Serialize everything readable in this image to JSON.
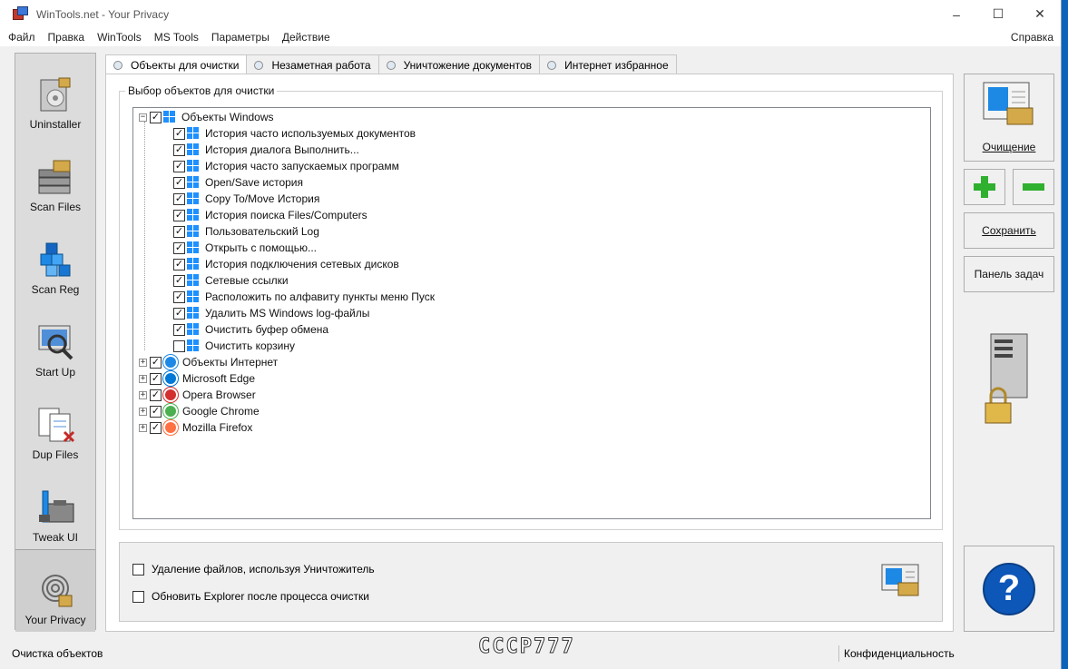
{
  "window": {
    "title": "WinTools.net - Your Privacy",
    "min": "–",
    "max": "☐",
    "close": "✕"
  },
  "menu": [
    "Файл",
    "Правка",
    "WinTools",
    "MS Tools",
    "Параметры",
    "Действие"
  ],
  "menu_help": "Справка",
  "nav": [
    {
      "label": "Uninstaller",
      "icon": "uninstaller-icon"
    },
    {
      "label": "Scan Files",
      "icon": "scan-files-icon"
    },
    {
      "label": "Scan Reg",
      "icon": "scan-reg-icon"
    },
    {
      "label": "Start Up",
      "icon": "startup-icon"
    },
    {
      "label": "Dup Files",
      "icon": "dup-files-icon"
    },
    {
      "label": "Tweak UI",
      "icon": "tweak-ui-icon"
    },
    {
      "label": "Your Privacy",
      "icon": "privacy-icon",
      "active": true
    }
  ],
  "tabs": [
    "Объекты для очистки",
    "Незаметная работа",
    "Уничтожение документов",
    "Интернет избранное"
  ],
  "group_title": "Выбор объектов для очистки",
  "tree": {
    "root": {
      "label": "Объекты Windows",
      "checked": true,
      "expanded": true
    },
    "children": [
      {
        "label": "История часто используемых документов",
        "checked": true
      },
      {
        "label": "История диалога Выполнить...",
        "checked": true
      },
      {
        "label": "История часто запускаемых программ",
        "checked": true
      },
      {
        "label": "Open/Save история",
        "checked": true
      },
      {
        "label": "Copy To/Move История",
        "checked": true
      },
      {
        "label": "История поиска Files/Computers",
        "checked": true
      },
      {
        "label": "Пользовательский Log",
        "checked": true
      },
      {
        "label": "Открыть с помощью...",
        "checked": true
      },
      {
        "label": "История подключения сетевых дисков",
        "checked": true
      },
      {
        "label": "Сетевые ссылки",
        "checked": true
      },
      {
        "label": "Расположить по алфавиту пункты меню Пуск",
        "checked": true
      },
      {
        "label": "Удалить MS Windows log-файлы",
        "checked": true
      },
      {
        "label": "Очистить буфер обмена",
        "checked": true
      },
      {
        "label": "Очистить корзину",
        "checked": false
      }
    ],
    "others": [
      {
        "label": "Объекты Интернет",
        "checked": true,
        "icon": "internet-explorer-icon",
        "color": "#1e88e5"
      },
      {
        "label": "Microsoft Edge",
        "checked": true,
        "icon": "edge-icon",
        "color": "#0078d7"
      },
      {
        "label": "Opera Browser",
        "checked": true,
        "icon": "opera-icon",
        "color": "#d32f2f"
      },
      {
        "label": "Google Chrome",
        "checked": true,
        "icon": "chrome-icon",
        "color": "#4caf50"
      },
      {
        "label": "Mozilla Firefox",
        "checked": true,
        "icon": "firefox-icon",
        "color": "#ff7043"
      }
    ]
  },
  "options": [
    {
      "label": "Удаление файлов, используя Уничтожитель",
      "checked": false
    },
    {
      "label": "Обновить Explorer после процесса очистки",
      "checked": false
    }
  ],
  "right": {
    "clean_label": "Очищение",
    "add": "+",
    "remove": "–",
    "save_label": "Сохранить",
    "taskbar_label": "Панель задач",
    "help_glyph": "?"
  },
  "status": {
    "left": "Очистка объектов",
    "right": "Конфиденциальность"
  },
  "watermark": "CCCP777"
}
